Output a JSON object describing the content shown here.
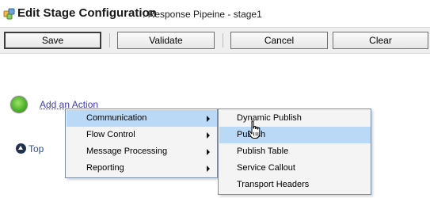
{
  "title": {
    "main": "Edit Stage Configuration",
    "sub": ": Response Pipeine - stage1"
  },
  "toolbar": {
    "save": "Save",
    "validate": "Validate",
    "cancel": "Cancel",
    "clear": "Clear"
  },
  "stage": {
    "add_action": "Add an Action",
    "top_link": "Top"
  },
  "action_menu": {
    "items": [
      {
        "label": "Communication",
        "has_submenu": true,
        "highlighted": true
      },
      {
        "label": "Flow Control",
        "has_submenu": true
      },
      {
        "label": "Message Processing",
        "has_submenu": true
      },
      {
        "label": "Reporting",
        "has_submenu": true
      }
    ]
  },
  "communication_menu": {
    "items": [
      {
        "label": "Dynamic Publish"
      },
      {
        "label": "Publish",
        "highlighted": true
      },
      {
        "label": "Publish Table"
      },
      {
        "label": "Service Callout"
      },
      {
        "label": "Transport Headers"
      }
    ]
  },
  "icons": {
    "title": "stage-config-icon",
    "status": "green-status-dot-icon",
    "top": "up-arrow-icon",
    "cursor": "hand-pointer-icon"
  },
  "colors": {
    "highlight": "#b9d9f7",
    "link": "#3b3bb3",
    "status_green": "#4fb52b"
  }
}
